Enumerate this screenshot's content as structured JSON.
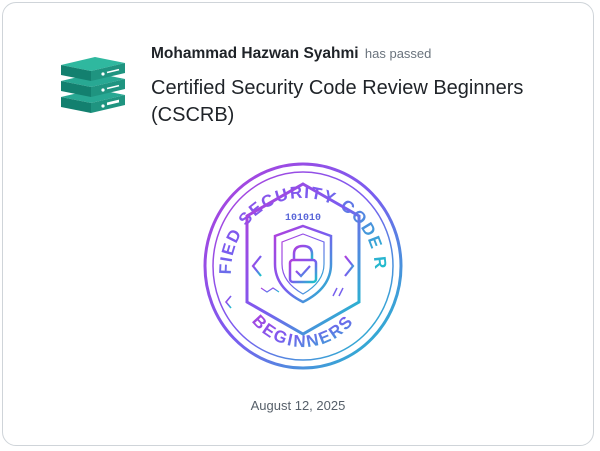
{
  "issuer_icon": "server-stack-icon",
  "recipient": {
    "name": "Mohammad Hazwan Syahmi",
    "status_text": "has passed"
  },
  "certification": {
    "title": "Certified Security Code Review Beginners (CSCRB)"
  },
  "badge": {
    "arc_top_text": "CERTIFIED SECURITY CODE REVIEW",
    "arc_bottom_text": "BEGINNERS",
    "binary_text": "101010",
    "icon": "shield-lock-icon",
    "gradient_colors": [
      "#b23fdb",
      "#7a5cf0",
      "#19c6c9"
    ]
  },
  "date": "August 12, 2025",
  "colors": {
    "accent": "#1f8a7a"
  }
}
